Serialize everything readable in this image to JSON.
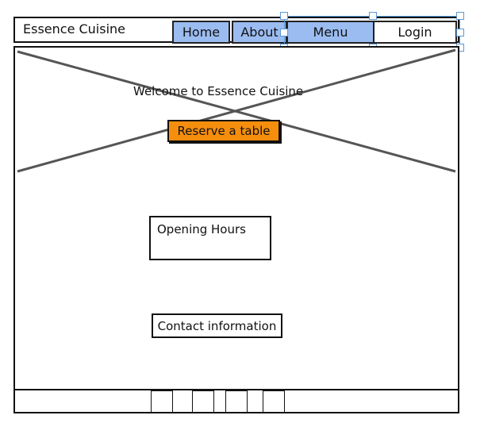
{
  "header": {
    "brand": "Essence Cuisine",
    "nav": [
      {
        "label": "Home"
      },
      {
        "label": "About"
      },
      {
        "label": "Menu"
      },
      {
        "label": "Login"
      }
    ]
  },
  "hero": {
    "welcome": "Welcome to Essence Cuisine",
    "reserve_label": "Reserve a table"
  },
  "main": {
    "opening_hours": "Opening Hours",
    "contact": "Contact information"
  },
  "colors": {
    "nav_blue": "#9bbcf0",
    "accent_orange": "#f58e0d",
    "selection_blue": "#5a9ad8"
  }
}
